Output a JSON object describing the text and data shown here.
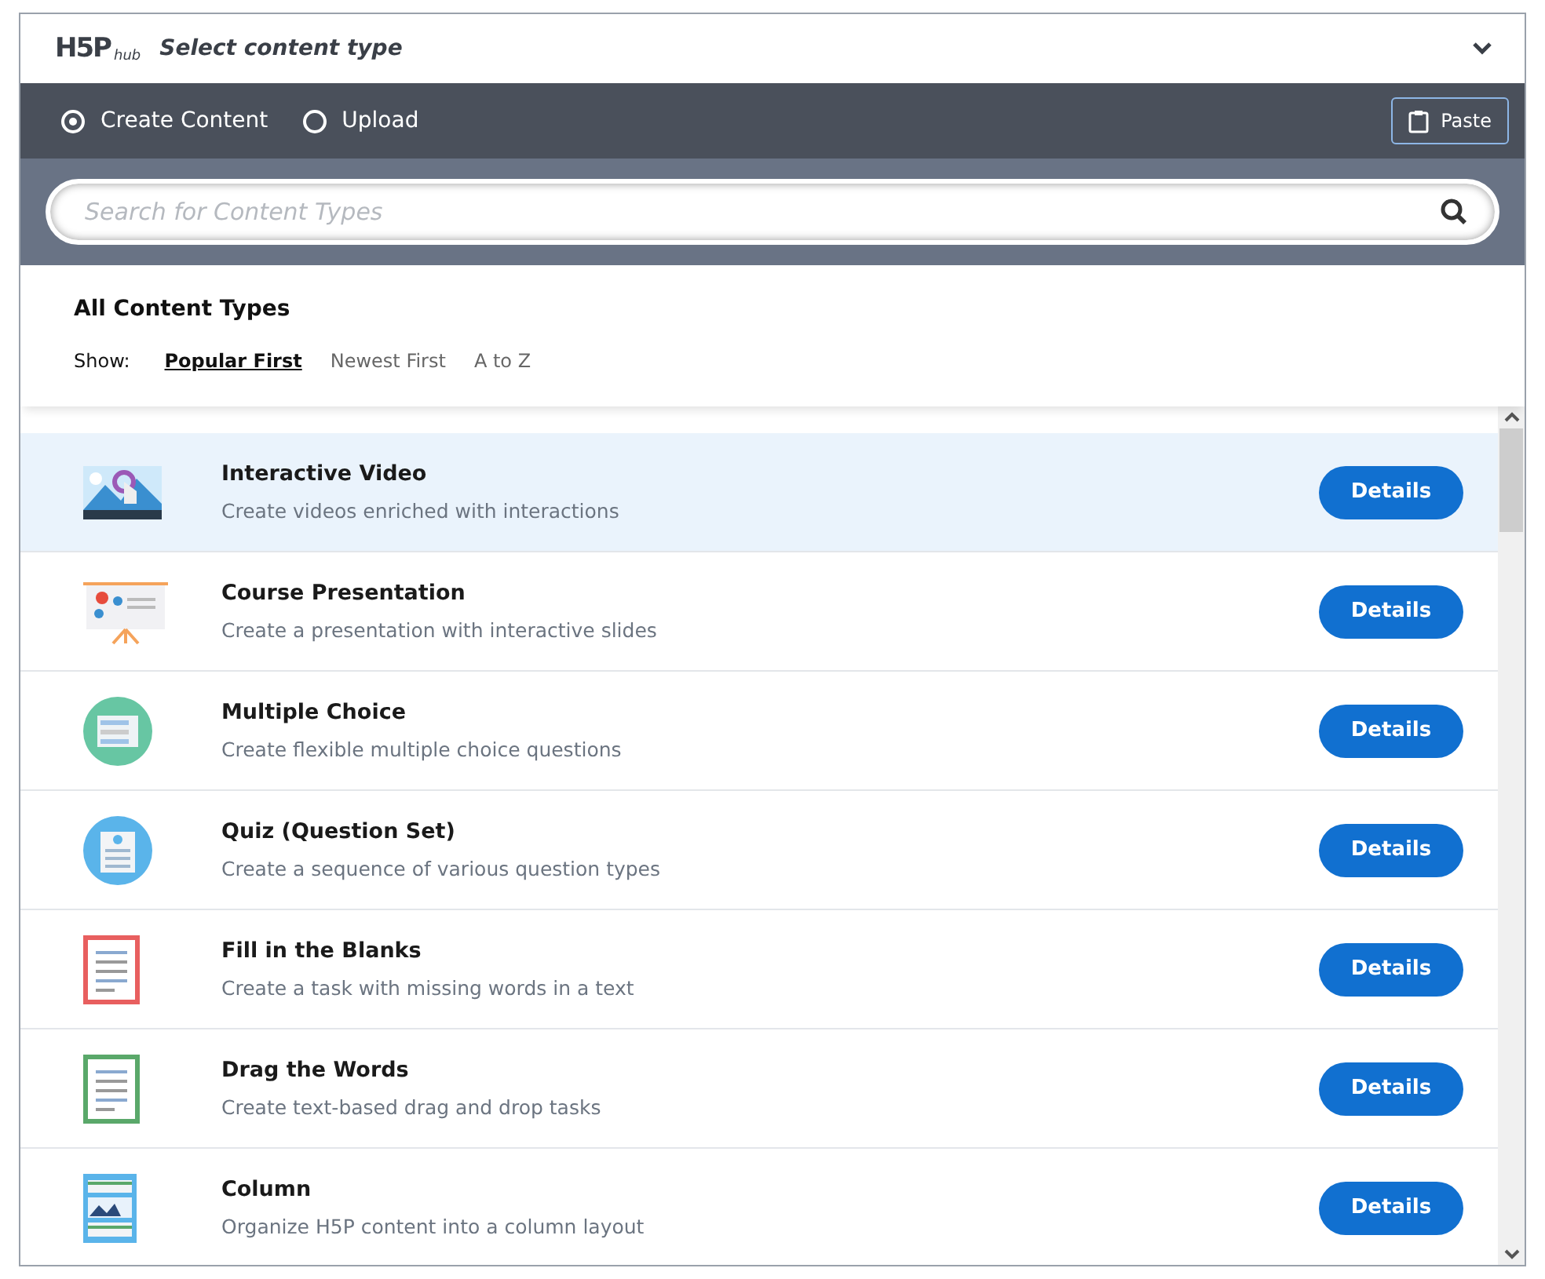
{
  "header": {
    "logo": "H5P",
    "logo_suffix": "hub",
    "title": "Select content type",
    "expanded": true
  },
  "modes": [
    {
      "label": "Create Content",
      "selected": true
    },
    {
      "label": "Upload",
      "selected": false
    }
  ],
  "paste_button": "Paste",
  "search": {
    "placeholder": "Search for Content Types"
  },
  "section_title": "All Content Types",
  "sort": {
    "label": "Show:",
    "options": [
      {
        "label": "Popular First",
        "selected": true
      },
      {
        "label": "Newest First",
        "selected": false
      },
      {
        "label": "A to Z",
        "selected": false
      }
    ]
  },
  "items": [
    {
      "kind": "video",
      "title": "Interactive Video",
      "description": "Create videos enriched with interactions",
      "highlighted": true,
      "button": "Details"
    },
    {
      "kind": "presentation",
      "title": "Course Presentation",
      "description": "Create a presentation with interactive slides",
      "highlighted": false,
      "button": "Details"
    },
    {
      "kind": "choice",
      "title": "Multiple Choice",
      "description": "Create flexible multiple choice questions",
      "highlighted": false,
      "button": "Details"
    },
    {
      "kind": "quiz",
      "title": "Quiz (Question Set)",
      "description": "Create a sequence of various question types",
      "highlighted": false,
      "button": "Details"
    },
    {
      "kind": "blanks",
      "title": "Fill in the Blanks",
      "description": "Create a task with missing words in a text",
      "highlighted": false,
      "button": "Details"
    },
    {
      "kind": "words",
      "title": "Drag the Words",
      "description": "Create text-based drag and drop tasks",
      "highlighted": false,
      "button": "Details"
    },
    {
      "kind": "column",
      "title": "Column",
      "description": "Organize H5P content into a column layout",
      "highlighted": false,
      "button": "Details"
    }
  ]
}
